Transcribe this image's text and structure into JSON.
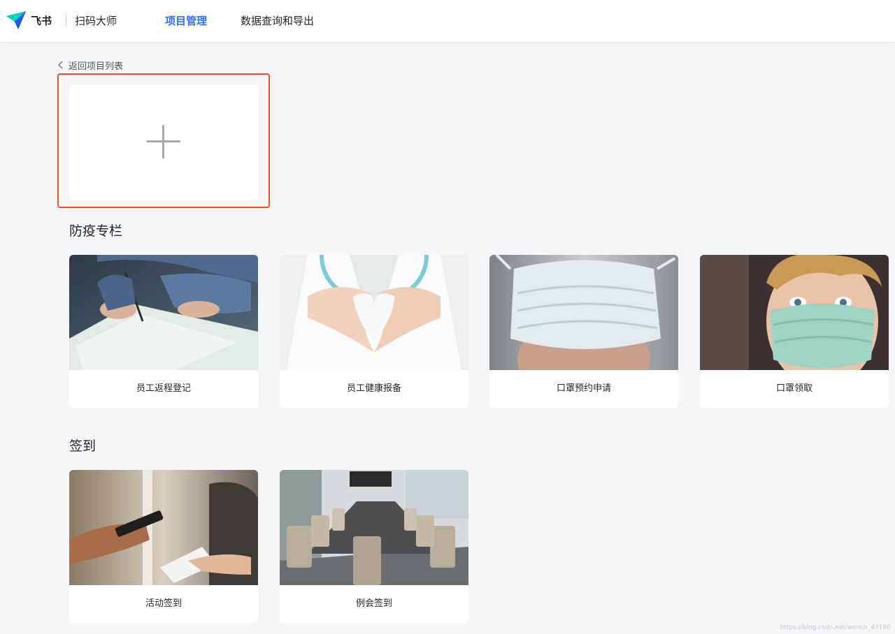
{
  "header": {
    "brand": "飞书",
    "app_name": "扫码大师",
    "tabs": [
      {
        "label": "项目管理",
        "active": true
      },
      {
        "label": "数据查询和导出",
        "active": false
      }
    ]
  },
  "back_link": {
    "label": "返回项目列表",
    "icon": "chevron-left-icon"
  },
  "create_card": {
    "icon": "plus-icon",
    "highlight_color": "#e8542d"
  },
  "sections": [
    {
      "title": "防疫专栏",
      "cards": [
        {
          "label": "员工返程登记",
          "image": "hand-writing-form-photo"
        },
        {
          "label": "员工健康报备",
          "image": "doctor-heart-hands-photo"
        },
        {
          "label": "口罩预约申请",
          "image": "surgical-mask-photo"
        },
        {
          "label": "口罩领取",
          "image": "child-wearing-mask-photo"
        }
      ]
    },
    {
      "title": "签到",
      "cards": [
        {
          "label": "活动签到",
          "image": "phone-and-paper-handoff-photo"
        },
        {
          "label": "例会签到",
          "image": "conference-room-photo"
        }
      ]
    }
  ],
  "watermark": "https://blog.csdn.net/weixin_47160",
  "colors": {
    "accent": "#3370ff",
    "background": "#f5f6f7",
    "card": "#ffffff",
    "highlight": "#e8542d"
  }
}
